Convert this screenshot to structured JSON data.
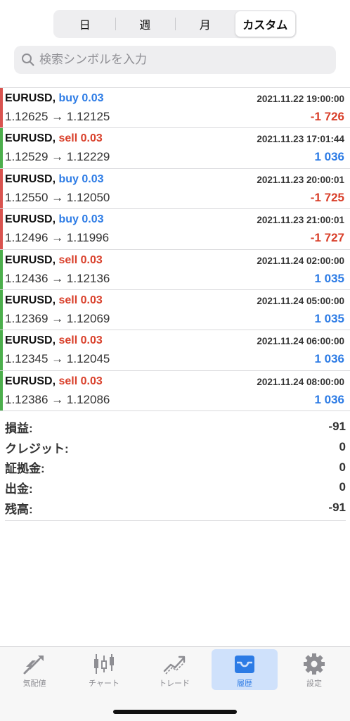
{
  "period_tabs": [
    {
      "label": "日",
      "active": false
    },
    {
      "label": "週",
      "active": false
    },
    {
      "label": "月",
      "active": false
    },
    {
      "label": "カスタム",
      "active": true
    }
  ],
  "search": {
    "placeholder": "検索シンボルを入力",
    "icon": "search-icon"
  },
  "colors": {
    "buy": "#2c7be5",
    "sell": "#d9402b",
    "loss": "#d9402b",
    "gain": "#2c7be5",
    "buy_bar": "#d9534f",
    "sell_bar": "#4cae4c"
  },
  "deals": [
    {
      "symbol": "EURUSD,",
      "type": "buy",
      "volume": "0.03",
      "time": "2021.11.22 19:00:00",
      "prices": "1.12625 → 1.12125",
      "profit": "-1 726",
      "profit_sign": "loss"
    },
    {
      "symbol": "EURUSD,",
      "type": "sell",
      "volume": "0.03",
      "time": "2021.11.23 17:01:44",
      "prices": "1.12529 → 1.12229",
      "profit": "1 036",
      "profit_sign": "gain"
    },
    {
      "symbol": "EURUSD,",
      "type": "buy",
      "volume": "0.03",
      "time": "2021.11.23 20:00:01",
      "prices": "1.12550 → 1.12050",
      "profit": "-1 725",
      "profit_sign": "loss"
    },
    {
      "symbol": "EURUSD,",
      "type": "buy",
      "volume": "0.03",
      "time": "2021.11.23 21:00:01",
      "prices": "1.12496 → 1.11996",
      "profit": "-1 727",
      "profit_sign": "loss"
    },
    {
      "symbol": "EURUSD,",
      "type": "sell",
      "volume": "0.03",
      "time": "2021.11.24 02:00:00",
      "prices": "1.12436 → 1.12136",
      "profit": "1 035",
      "profit_sign": "gain"
    },
    {
      "symbol": "EURUSD,",
      "type": "sell",
      "volume": "0.03",
      "time": "2021.11.24 05:00:00",
      "prices": "1.12369 → 1.12069",
      "profit": "1 035",
      "profit_sign": "gain"
    },
    {
      "symbol": "EURUSD,",
      "type": "sell",
      "volume": "0.03",
      "time": "2021.11.24 06:00:00",
      "prices": "1.12345 → 1.12045",
      "profit": "1 036",
      "profit_sign": "gain"
    },
    {
      "symbol": "EURUSD,",
      "type": "sell",
      "volume": "0.03",
      "time": "2021.11.24 08:00:00",
      "prices": "1.12386 → 1.12086",
      "profit": "1 036",
      "profit_sign": "gain"
    }
  ],
  "summary": [
    {
      "label": "損益:",
      "value": "-91"
    },
    {
      "label": "クレジット:",
      "value": "0"
    },
    {
      "label": "証拠金:",
      "value": "0"
    },
    {
      "label": "出金:",
      "value": "0"
    },
    {
      "label": "残高:",
      "value": "-91"
    }
  ],
  "tabbar": [
    {
      "label": "気配値",
      "icon": "quotes-icon",
      "active": false
    },
    {
      "label": "チャート",
      "icon": "candlestick-chart-icon",
      "active": false
    },
    {
      "label": "トレード",
      "icon": "trade-trend-icon",
      "active": false
    },
    {
      "label": "履歴",
      "icon": "history-inbox-icon",
      "active": true
    },
    {
      "label": "設定",
      "icon": "gear-icon",
      "active": false
    }
  ]
}
